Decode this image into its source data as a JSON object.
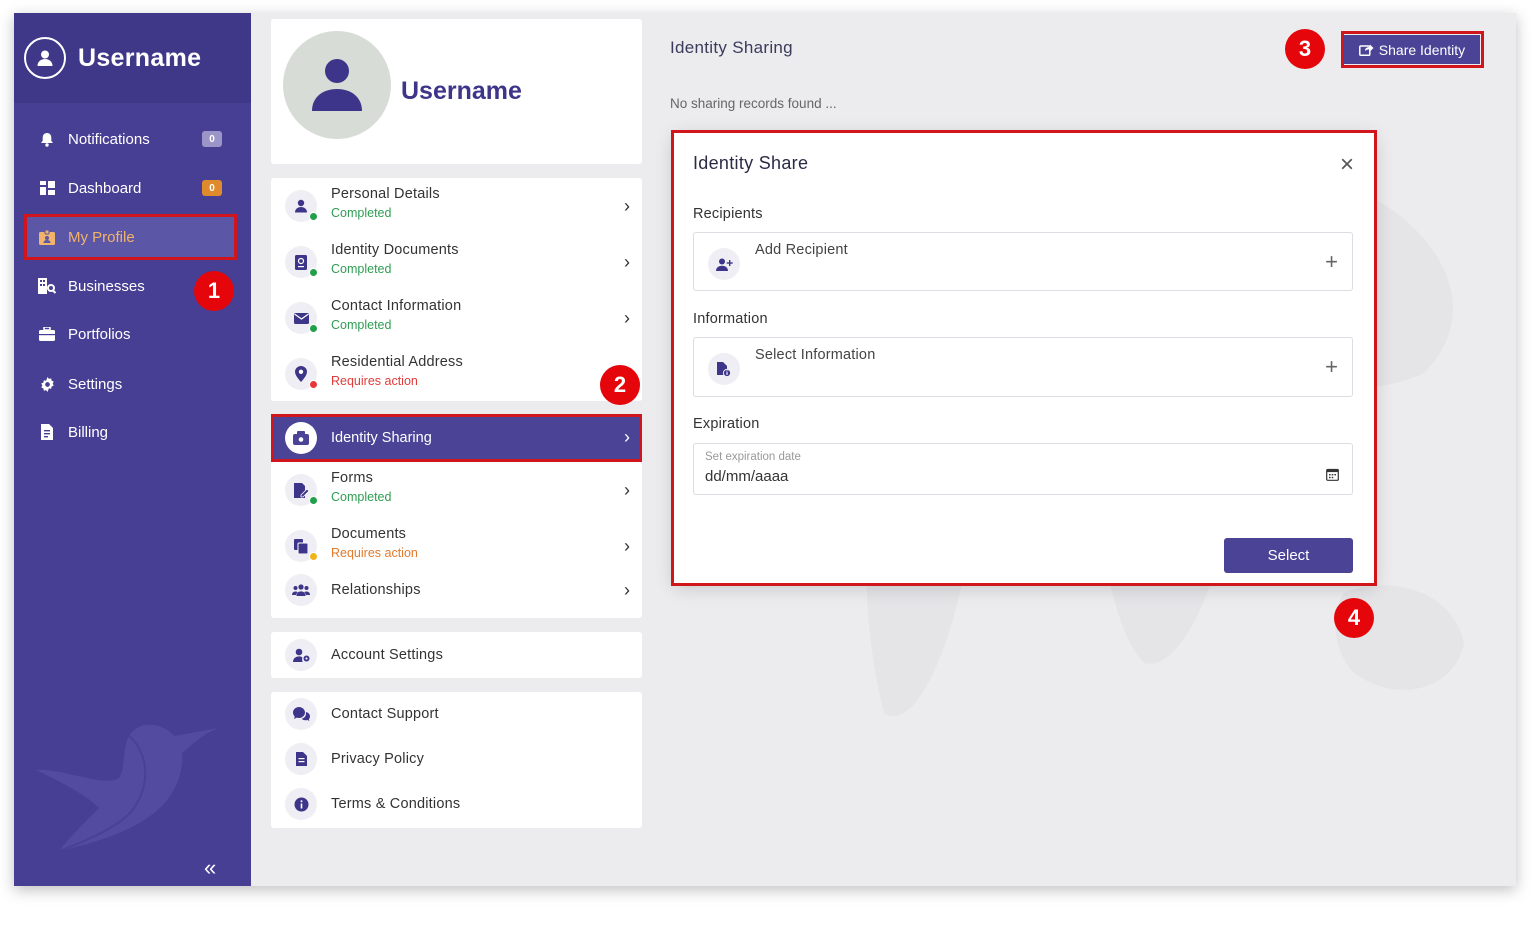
{
  "sidebar": {
    "username": "Username",
    "items": [
      {
        "label": "Notifications",
        "icon": "bell-icon",
        "badge": "0",
        "badge_color": "#9b96c7"
      },
      {
        "label": "Dashboard",
        "icon": "dashboard-icon",
        "badge": "0",
        "badge_color": "#e08a2e"
      },
      {
        "label": "My Profile",
        "icon": "profile-card-icon",
        "active": true
      },
      {
        "label": "Businesses",
        "icon": "business-search-icon"
      },
      {
        "label": "Portfolios",
        "icon": "briefcase-icon"
      },
      {
        "label": "Settings",
        "icon": "gear-icon"
      },
      {
        "label": "Billing",
        "icon": "invoice-icon"
      }
    ],
    "collapse_glyph": "«"
  },
  "profile": {
    "name": "Username",
    "menu": [
      {
        "title": "Personal Details",
        "status": "Completed",
        "status_color": "#2e9e52",
        "icon": "user-icon"
      },
      {
        "title": "Identity Documents",
        "status": "Completed",
        "status_color": "#2e9e52",
        "icon": "passport-icon"
      },
      {
        "title": "Contact Information",
        "status": "Completed",
        "status_color": "#2e9e52",
        "icon": "envelope-icon"
      },
      {
        "title": "Residential Address",
        "status": "Requires action",
        "status_color": "#e03b3b",
        "icon": "map-pin-icon"
      }
    ],
    "active_item": {
      "title": "Identity Sharing",
      "icon": "id-share-icon"
    },
    "menu2": [
      {
        "title": "Forms",
        "status": "Completed",
        "status_color": "#2e9e52",
        "icon": "form-edit-icon"
      },
      {
        "title": "Documents",
        "status": "Requires action",
        "status_color": "#e07a2e",
        "icon": "documents-icon"
      },
      {
        "title": "Relationships",
        "icon": "users-icon"
      }
    ],
    "account_settings": "Account Settings",
    "links": [
      {
        "title": "Contact Support",
        "icon": "chat-icon"
      },
      {
        "title": "Privacy Policy",
        "icon": "file-icon"
      },
      {
        "title": "Terms & Conditions",
        "icon": "info-icon"
      }
    ]
  },
  "main": {
    "title": "Identity Sharing",
    "share_button": "Share Identity",
    "empty_message": "No sharing records found ..."
  },
  "modal": {
    "title": "Identity Share",
    "close": "×",
    "recipients_label": "Recipients",
    "add_recipient": "Add Recipient",
    "information_label": "Information",
    "select_information": "Select Information",
    "expiration_label": "Expiration",
    "date_placeholder": "Set expiration date",
    "date_value": "dd/mm/aaaa",
    "select_button": "Select",
    "plus": "+"
  },
  "callouts": [
    "1",
    "2",
    "3",
    "4"
  ],
  "colors": {
    "brand": "#473f93",
    "highlight": "#d0161c",
    "callout": "#e4060b"
  }
}
